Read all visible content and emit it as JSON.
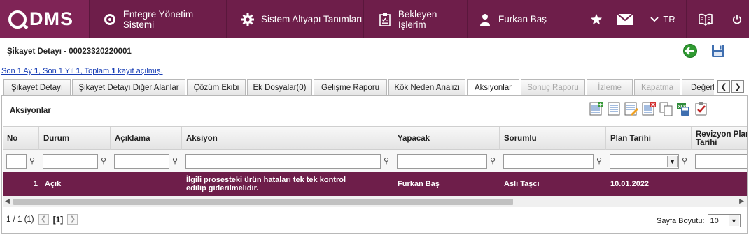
{
  "app": {
    "logo_text": "DMS"
  },
  "nav": {
    "entegre": "Entegre Yönetim Sistemi",
    "sistem": "Sistem Altyapı Tanımları",
    "bekleyen": "Bekleyen İşlerim",
    "user": "Furkan Baş",
    "language": "TR"
  },
  "page": {
    "title": "Şikayet Detayı - 00023320220001",
    "info_pre1": "Son 1 Ay ",
    "info_n1": "1",
    "info_pre2": ", Son 1 Yıl ",
    "info_n2": "1",
    "info_pre3": ", Toplam ",
    "info_n3": "1",
    "info_post": " kayıt açılmış."
  },
  "tabs": [
    {
      "label": "Şikayet Detayı"
    },
    {
      "label": "Şikayet Detayı Diğer Alanlar"
    },
    {
      "label": "Çözüm Ekibi"
    },
    {
      "label": "Ek Dosyalar(0)"
    },
    {
      "label": "Gelişme Raporu"
    },
    {
      "label": "Kök Neden Analizi"
    },
    {
      "label": "Aksiyonlar"
    },
    {
      "label": "Sonuç Raporu"
    },
    {
      "label": "İzleme"
    },
    {
      "label": "Kapatma"
    },
    {
      "label": "Değerlendirme"
    }
  ],
  "panel": {
    "title": "Aksiyonlar"
  },
  "grid": {
    "columns": {
      "no": "No",
      "durum": "Durum",
      "aciklama": "Açıklama",
      "aksiyon": "Aksiyon",
      "yapacak": "Yapacak",
      "sorumlu": "Sorumlu",
      "plan_tarihi": "Plan Tarihi",
      "revizyon_1": "Revizyon Plan",
      "revizyon_2": "Tarihi"
    },
    "rows": [
      {
        "no": "1",
        "durum": "Açık",
        "aciklama": "",
        "aksiyon": "İlgili prosesteki ürün hataları tek tek kontrol edilip giderilmelidir.",
        "yapacak": "Furkan Baş",
        "sorumlu": "Aslı Taşcı",
        "plan_tarihi": "10.01.2022"
      }
    ]
  },
  "pager": {
    "summary": "1 / 1 (1)",
    "current": "[1]",
    "page_size_label": "Sayfa Boyutu:",
    "page_size": "10"
  },
  "colors": {
    "brand": "#6e1e4a",
    "logo_bg": "#7f2456",
    "link": "#1a3fb5",
    "back_button": "#2f9a31"
  }
}
